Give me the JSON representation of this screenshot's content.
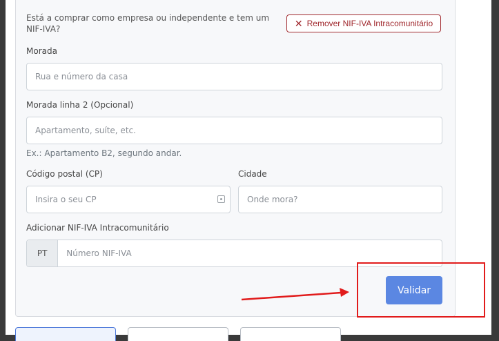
{
  "form": {
    "question": "Está a comprar como empresa ou independente e tem um NIF-IVA?",
    "remove_button": "Remover NIF-IVA Intracomunitário",
    "address": {
      "label": "Morada",
      "placeholder": "Rua e número da casa"
    },
    "address2": {
      "label": "Morada linha 2 (Opcional)",
      "placeholder": "Apartamento, suíte, etc.",
      "hint": "Ex.: Apartamento B2, segundo andar."
    },
    "postal": {
      "label": "Código postal (CP)",
      "placeholder": "Insira o seu CP"
    },
    "city": {
      "label": "Cidade",
      "placeholder": "Onde mora?"
    },
    "vat": {
      "label": "Adicionar NIF-IVA Intracomunitário",
      "prefix": "PT",
      "placeholder": "Número NIF-IVA"
    },
    "validate_button": "Validar"
  },
  "colors": {
    "accent": "#5b87e2",
    "danger": "#a0282d",
    "annotation": "#e11b1b"
  }
}
